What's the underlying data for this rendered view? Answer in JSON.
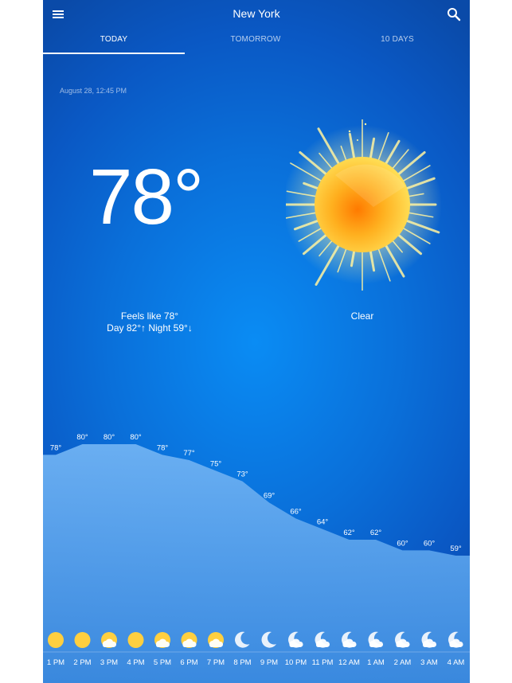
{
  "header": {
    "city": "New York",
    "menu_icon": "menu-icon",
    "search_icon": "search-icon"
  },
  "tabs": [
    {
      "label": "TODAY",
      "active": true
    },
    {
      "label": "TOMORROW",
      "active": false
    },
    {
      "label": "10 DAYS",
      "active": false
    }
  ],
  "current": {
    "date": "August 28, 12:45 PM",
    "temperature": "78°",
    "feels_like": "Feels like 78°",
    "day_night": "Day 82°↑  Night 59°↓",
    "condition": "Clear",
    "condition_icon": "sun-icon"
  },
  "hourly": [
    {
      "time": "1 PM",
      "temp": 78,
      "temp_label": "78°",
      "icon": "sun-icon"
    },
    {
      "time": "2 PM",
      "temp": 80,
      "temp_label": "80°",
      "icon": "sun-icon"
    },
    {
      "time": "3 PM",
      "temp": 80,
      "temp_label": "80°",
      "icon": "sun-cloud-icon"
    },
    {
      "time": "4 PM",
      "temp": 80,
      "temp_label": "80°",
      "icon": "sun-icon"
    },
    {
      "time": "5 PM",
      "temp": 78,
      "temp_label": "78°",
      "icon": "sun-cloud-icon"
    },
    {
      "time": "6 PM",
      "temp": 77,
      "temp_label": "77°",
      "icon": "sun-cloud-icon"
    },
    {
      "time": "7 PM",
      "temp": 75,
      "temp_label": "75°",
      "icon": "sun-cloud-icon"
    },
    {
      "time": "8 PM",
      "temp": 73,
      "temp_label": "73°",
      "icon": "moon-icon"
    },
    {
      "time": "9 PM",
      "temp": 69,
      "temp_label": "69°",
      "icon": "moon-icon"
    },
    {
      "time": "10 PM",
      "temp": 66,
      "temp_label": "66°",
      "icon": "moon-cloud-icon"
    },
    {
      "time": "11 PM",
      "temp": 64,
      "temp_label": "64°",
      "icon": "moon-cloud-icon"
    },
    {
      "time": "12 AM",
      "temp": 62,
      "temp_label": "62°",
      "icon": "moon-cloud-icon"
    },
    {
      "time": "1 AM",
      "temp": 62,
      "temp_label": "62°",
      "icon": "moon-cloud-icon"
    },
    {
      "time": "2 AM",
      "temp": 60,
      "temp_label": "60°",
      "icon": "moon-cloud-icon"
    },
    {
      "time": "3 AM",
      "temp": 60,
      "temp_label": "60°",
      "icon": "moon-cloud-icon"
    },
    {
      "time": "4 AM",
      "temp": 59,
      "temp_label": "59°",
      "icon": "moon-cloud-icon"
    }
  ],
  "colors": {
    "background": "#0a6fd9",
    "sun": "#ffd54f",
    "sun_core": "#ff7a00",
    "chart_fill": "#5ea7ee"
  }
}
